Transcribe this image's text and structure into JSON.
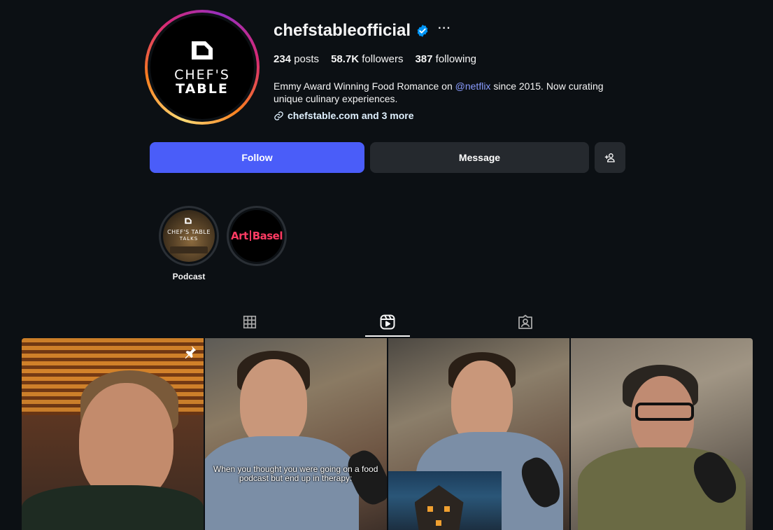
{
  "profile": {
    "username": "chefstableofficial",
    "verified_icon": "verified-badge-icon",
    "more_label": "···",
    "avatar": {
      "logo_line1": "CHEF'S",
      "logo_line2": "TABLE"
    },
    "stats": {
      "posts_count": "234",
      "posts_label": "posts",
      "followers_count": "58.7K",
      "followers_label": "followers",
      "following_count": "387",
      "following_label": "following"
    },
    "bio": {
      "text_before": "Emmy Award Winning Food Romance on ",
      "mention": "@netflix",
      "text_after": " since 2015. Now curating unique culinary experiences."
    },
    "link": {
      "icon": "link-icon",
      "text": "chefstable.com and 3 more"
    }
  },
  "actions": {
    "follow_label": "Follow",
    "message_label": "Message",
    "suggest_icon": "add-person-icon"
  },
  "highlights": [
    {
      "label": "Podcast",
      "cover_text_1": "CHEF'S TABLE",
      "cover_text_2": "TALKS"
    },
    {
      "label": "",
      "cover_text_1": "Art",
      "cover_text_2": "Basel"
    }
  ],
  "tabs": [
    {
      "name": "posts",
      "icon": "grid-icon",
      "active": false
    },
    {
      "name": "reels",
      "icon": "reels-icon",
      "active": true
    },
    {
      "name": "tagged",
      "icon": "tagged-icon",
      "active": false
    }
  ],
  "grid": {
    "tiles": [
      {
        "pinned": true,
        "pin_icon": "pin-icon",
        "caption": ""
      },
      {
        "pinned": false,
        "caption": "When you thought you were going on a food podcast but end up in therapy:"
      },
      {
        "pinned": false,
        "caption": ""
      },
      {
        "pinned": false,
        "caption": ""
      }
    ]
  },
  "colors": {
    "background": "#0c1014",
    "follow_button": "#4a5df9",
    "secondary_button": "#25292e",
    "mention": "#8a9cff",
    "verified": "#0095f6"
  }
}
